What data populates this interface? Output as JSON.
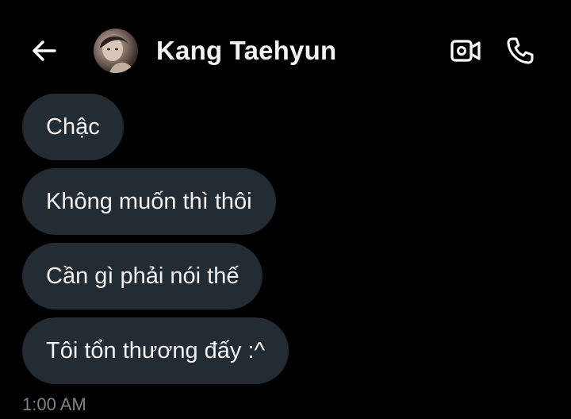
{
  "header": {
    "contact_name": "Kang Taehyun",
    "icons": {
      "back": "back-arrow-icon",
      "avatar": "avatar",
      "video": "video-camera-icon",
      "call": "phone-icon"
    }
  },
  "messages": [
    {
      "text": "Chậc"
    },
    {
      "text": "Không muốn thì thôi"
    },
    {
      "text": "Cần gì phải nói thế"
    },
    {
      "text": "Tôi tổn thương đấy :^"
    }
  ],
  "timestamp": "1:00 AM",
  "colors": {
    "background": "#000000",
    "bubble": "#232b33",
    "text": "#f0f2f4",
    "muted": "#7c8389"
  }
}
